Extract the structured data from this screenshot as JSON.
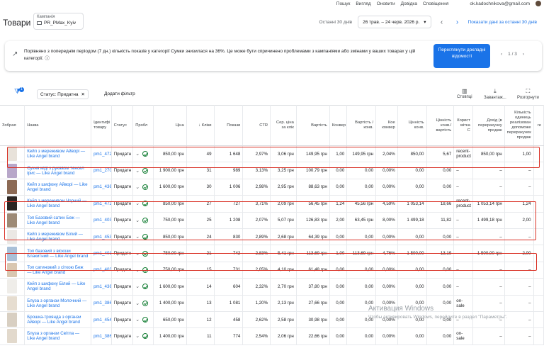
{
  "topbar": {
    "items": [
      "Пошук",
      "Вигляд",
      "Оновити",
      "Довідка",
      "Сповіщення"
    ],
    "email": "ok.kadochnikova@gmail.com"
  },
  "header": {
    "title": "Товари",
    "campaign_label": "Кампанія",
    "campaign_value": "PR_PMax_Kyiv",
    "range_label": "Останні 30 днів",
    "date_range": "26 трав. – 24 черв. 2026 р.",
    "show_data_link": "Показати дані за останні 30 днів"
  },
  "alert": {
    "message": "Порівняно з попереднім періодом (7 дн.) кількість показів у категорії Сумки знизилася на 36%. Це може бути спричинено проблемами з кампаніями або змінами у ваших товарах у цій категорії.",
    "cta": "Переглянути докладні відомості",
    "pager": "1 / 3"
  },
  "filters": {
    "badge": "1",
    "chip_label": "Статус: Придатна",
    "add_filter": "Додати фільтр",
    "tools": [
      "Стовпці",
      "Завантаж...",
      "Розгорнути"
    ]
  },
  "table": {
    "headers": [
      "Зобрая",
      "Назва",
      "Ідентифі товару",
      "Статус",
      "Пробл",
      "Ціна",
      "↓ Кліки",
      "Покази",
      "CTR",
      "Сер. ціна за клік",
      "Вартість",
      "Конвер",
      "Вартість / конв.",
      "Кое конвер",
      "Цінність конв.",
      "Цінність конв./ вартість",
      "Корист мітка C",
      "Дохід (в перерахунку продаж",
      "Кількість одиниць реалізован допоможе перерахунок продаж",
      "re"
    ],
    "rows": [
      {
        "name": "Кейп з мереживом Айворі — Like Angel brand",
        "id": "pm1_472",
        "status": "Придатн",
        "price": "850,00 грн",
        "clicks": "49",
        "impr": "1 648",
        "ctr": "2,97%",
        "cpc": "3,06 грн",
        "cost": "149,95 грн",
        "conv": "1,00",
        "cpa": "149,95 грн",
        "cr": "2,04%",
        "cv": "850,00",
        "roas": "5,67",
        "label": "recent-product",
        "rev": "850,00 грн",
        "units": "1,00",
        "color": "#e8e2da"
      },
      {
        "name": "Сукня міді з рукавом тенсел ірис — Like Angel brand",
        "id": "pm1_270",
        "status": "Придатн",
        "price": "1 900,00 грн",
        "clicks": "31",
        "impr": "989",
        "ctr": "3,13%",
        "cpc": "3,25 грн",
        "cost": "100,79 грн",
        "conv": "0,00",
        "cpa": "0,00",
        "cr": "0,00%",
        "cv": "0,00",
        "roas": "0,00",
        "label": "–",
        "rev": "–",
        "units": "–",
        "color": "#b8a7c9"
      },
      {
        "name": "Кейп з шифону Айворі — Like Angel brand",
        "id": "pm1_436",
        "status": "Придатн",
        "price": "1 600,00 грн",
        "clicks": "30",
        "impr": "1 006",
        "ctr": "2,98%",
        "cpc": "2,95 грн",
        "cost": "88,63 грн",
        "conv": "0,00",
        "cpa": "0,00",
        "cr": "0,00%",
        "cv": "0,00",
        "roas": "0,00",
        "label": "–",
        "rev": "–",
        "units": "–",
        "color": "#8c6a55"
      },
      {
        "name": "Кейп з мереживом Чорний — Like Angel brand",
        "id": "pm1_472",
        "status": "Придатн",
        "price": "850,00 грн",
        "clicks": "27",
        "impr": "727",
        "ctr": "3,71%",
        "cpc": "2,09 грн",
        "cost": "56,45 грн",
        "conv": "1,24",
        "cpa": "45,56 грн",
        "cr": "4,59%",
        "cv": "1 053,14",
        "roas": "18,66",
        "label": "recent-product",
        "rev": "1 053,14 грн",
        "units": "1,24",
        "color": "#2b2522"
      },
      {
        "name": "Топ Базовий сатин Беж — Like Angel brand",
        "id": "pm1_403",
        "status": "Придатн",
        "price": "750,00 грн",
        "clicks": "25",
        "impr": "1 208",
        "ctr": "2,07%",
        "cpc": "5,07 грн",
        "cost": "126,83 грн",
        "conv": "2,00",
        "cpa": "63,45 грн",
        "cr": "8,00%",
        "cv": "1 499,18",
        "roas": "11,82",
        "label": "–",
        "rev": "1 499,18 грн",
        "units": "2,00",
        "color": "#9d8a76"
      },
      {
        "name": "Кейп з мереживом Білий — Like Angel brand",
        "id": "pm1_453",
        "status": "Придатн",
        "price": "850,00 грн",
        "clicks": "24",
        "impr": "830",
        "ctr": "2,89%",
        "cpc": "2,68 грн",
        "cost": "64,39 грн",
        "conv": "0,00",
        "cpa": "0,00",
        "cr": "0,00%",
        "cv": "0,00",
        "roas": "0,00",
        "label": "–",
        "rev": "–",
        "units": "–",
        "color": "#ebe8e4"
      },
      {
        "name": "Топ базовий з віскози Блакитний — Like Angel brand",
        "id": "pm1_401",
        "status": "Придатн",
        "price": "750,00 грн",
        "clicks": "21",
        "impr": "742",
        "ctr": "2,83%",
        "cpc": "5,41 грн",
        "cost": "113,69 грн",
        "conv": "1,00",
        "cpa": "113,69 грн",
        "cr": "4,76%",
        "cv": "1 500,00",
        "roas": "13,19",
        "label": "–",
        "rev": "1 500,00 грн",
        "units": "2,00",
        "color": "#a9c0d8"
      },
      {
        "name": "Топ сатиновий з сіткою Беж — Like Angel brand",
        "id": "pm1_403",
        "status": "Придатн",
        "price": "750,00 грн",
        "clicks": "15",
        "impr": "731",
        "ctr": "2,05%",
        "cpc": "4,10 грн",
        "cost": "61,48 грн",
        "conv": "0,00",
        "cpa": "0,00",
        "cr": "0,00%",
        "cv": "0,00",
        "roas": "0,00",
        "label": "–",
        "rev": "–",
        "units": "–",
        "color": "#d9c7b1"
      },
      {
        "name": "Кейп з шифону Білий — Like Angel brand",
        "id": "pm1_436",
        "status": "Придатн",
        "price": "1 600,00 грн",
        "clicks": "14",
        "impr": "604",
        "ctr": "2,32%",
        "cpc": "2,70 грн",
        "cost": "37,80 грн",
        "conv": "0,00",
        "cpa": "0,00",
        "cr": "0,00%",
        "cv": "0,00",
        "roas": "0,00",
        "label": "–",
        "rev": "–",
        "units": "–",
        "color": "#efede9"
      },
      {
        "name": "Блуза з органзи Молочний — Like Angel brand",
        "id": "pm1_386",
        "status": "Придатн",
        "price": "1 400,00 грн",
        "clicks": "13",
        "impr": "1 081",
        "ctr": "1,20%",
        "cpc": "2,13 грн",
        "cost": "27,66 грн",
        "conv": "0,00",
        "cpa": "0,00",
        "cr": "0,00%",
        "cv": "0,00",
        "roas": "0,00",
        "label": "on-sale",
        "rev": "–",
        "units": "–",
        "color": "#e6ddd0"
      },
      {
        "name": "Брошка-троянда з органзи Айворі — Like Angel brand",
        "id": "pm1_454",
        "status": "Придатн",
        "price": "650,00 грн",
        "clicks": "12",
        "impr": "458",
        "ctr": "2,62%",
        "cpc": "2,58 грн",
        "cost": "30,98 грн",
        "conv": "0,00",
        "cpa": "0,00",
        "cr": "0,00%",
        "cv": "0,00",
        "roas": "0,00",
        "label": "–",
        "rev": "–",
        "units": "–",
        "color": "#d8cfc2"
      },
      {
        "name": "Блуза з органзи Світла — Like Angel brand",
        "id": "pm1_386",
        "status": "Придатн",
        "price": "1 400,00 грн",
        "clicks": "11",
        "impr": "774",
        "ctr": "2,54%",
        "cpc": "2,06 грн",
        "cost": "22,66 грн",
        "conv": "0,00",
        "cpa": "0,00",
        "cr": "0,00%",
        "cv": "0,00",
        "roas": "0,00",
        "label": "on-sale",
        "rev": "–",
        "units": "–",
        "color": "#e2d9cc"
      }
    ]
  },
  "watermark": {
    "title": "Активация Windows",
    "sub": "Чтобы активировать Windows, перейдите в раздел \"Параметры\"."
  }
}
